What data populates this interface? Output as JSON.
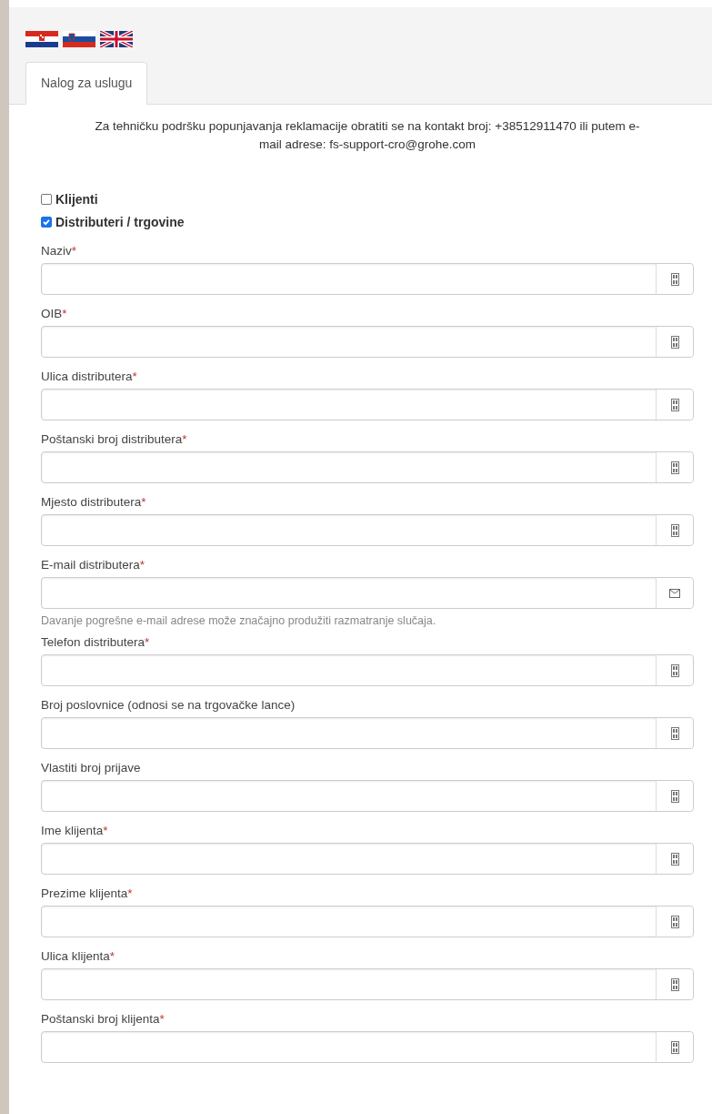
{
  "languages": [
    {
      "kind": "croatia"
    },
    {
      "kind": "slovenia"
    },
    {
      "kind": "uk"
    }
  ],
  "tabs": [
    {
      "label": "Nalog za uslugu",
      "selected": true
    }
  ],
  "support_notice": "Za tehničku podršku popunjavanja reklamacije obratiti se na kontakt broj: +38512911470 ili putem e-mail adrese: fs-support-cro@grohe.com",
  "customer_types": [
    {
      "label": "Klijenti",
      "checked": false
    },
    {
      "label": "Distributeri / trgovine",
      "checked": true
    }
  ],
  "fields": [
    {
      "label": "Naziv",
      "required_marker": "*",
      "kind": "text"
    },
    {
      "label": "OIB",
      "required_marker": "*",
      "kind": "text"
    },
    {
      "label": "Ulica distributera",
      "required_marker": "*",
      "kind": "text"
    },
    {
      "label": "Poštanski broj distributera",
      "required_marker": "*",
      "kind": "text"
    },
    {
      "label": "Mjesto distributera",
      "required_marker": "*",
      "kind": "text"
    },
    {
      "label": "E-mail distributera",
      "required_marker": "*",
      "kind": "email",
      "hint": "Davanje pogrešne e-mail adrese može značajno produžiti razmatranje slučaja."
    },
    {
      "label": "Telefon distributera",
      "required_marker": "*",
      "kind": "text"
    },
    {
      "label": "Broj poslovnice (odnosi se na trgovačke lance)",
      "kind": "text"
    },
    {
      "label": "Vlastiti broj prijave",
      "kind": "text"
    },
    {
      "label": "Ime klijenta",
      "required_marker": "*",
      "kind": "text"
    },
    {
      "label": "Prezime klijenta",
      "required_marker": "*",
      "kind": "text"
    },
    {
      "label": "Ulica klijenta",
      "required_marker": "*",
      "kind": "text"
    },
    {
      "label": "Poštanski broj klijenta",
      "required_marker": "*",
      "kind": "text"
    }
  ]
}
